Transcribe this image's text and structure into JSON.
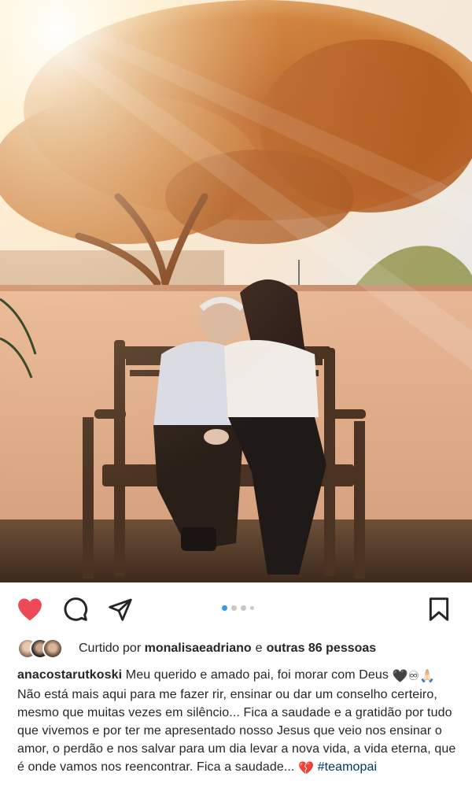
{
  "post": {
    "photo": {
      "description_icon": "photo-icon"
    },
    "carousel": {
      "count": 5,
      "active_index": 0
    },
    "colors": {
      "like_red": "#ed4956",
      "text": "#262626",
      "hashtag": "#00376b",
      "dot_active": "#3897f0",
      "dot_inactive": "#c7c7c7"
    },
    "actions": {
      "like_icon": "heart-filled-icon",
      "comment_icon": "comment-icon",
      "share_icon": "paper-plane-icon",
      "save_icon": "bookmark-icon"
    },
    "likes": {
      "prefix": "Curtido por",
      "user": "monalisaeadriano",
      "connector": "e",
      "others": "outras 86 pessoas"
    },
    "caption": {
      "username": "anacostarutkoski",
      "line1": " Meu querido e amado pai, foi morar com Deus ",
      "emoji1": "🖤♾🙏🏻",
      "text2": " Não está mais aqui para me fazer rir, ensinar ou dar um conselho certeiro, mesmo que muitas vezes em silêncio... Fica a saudade e a gratidão por tudo que vivemos e por ter me apresentado nosso Jesus que veio nos ensinar o amor, o perdão e nos salvar para um dia levar a nova vida, a vida eterna, que é onde vamos nos reencontrar. Fica a saudade... ",
      "emoji2": "💔",
      "hashtag": "#teamopai"
    }
  }
}
